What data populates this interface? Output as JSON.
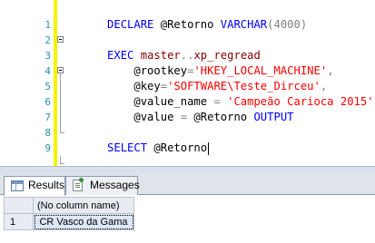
{
  "editor": {
    "lines": [
      {
        "num": "1"
      },
      {
        "num": "2"
      },
      {
        "num": "3"
      },
      {
        "num": "4"
      },
      {
        "num": "5"
      },
      {
        "num": "6"
      },
      {
        "num": "7"
      },
      {
        "num": "8"
      },
      {
        "num": "9"
      }
    ],
    "tokens": {
      "l1_declare": "DECLARE",
      "l1_var": " @Retorno ",
      "l1_type": "VARCHAR",
      "l1_size": "(4000)",
      "l3_exec": "EXEC",
      "l3_proc": " master",
      "l3_dots": "..",
      "l3_name": "xp_regread",
      "l4_param": "    @rootkey",
      "l4_eq": "=",
      "l4_val": "'HKEY_LOCAL_MACHINE'",
      "l4_comma": ",",
      "l5_param": "    @key",
      "l5_eq": "=",
      "l5_val": "'SOFTWARE\\Teste_Dirceu'",
      "l5_comma": ",",
      "l6_param": "    @value_name ",
      "l6_eq": "=",
      "l6_val": " 'Campeão Carioca 2015'",
      "l6_comma": ",",
      "l7_param": "    @value ",
      "l7_eq": "=",
      "l7_var": " @Retorno ",
      "l7_out": "OUTPUT",
      "l9_select": "SELECT",
      "l9_var": " @Retorno"
    }
  },
  "results": {
    "tabs": [
      {
        "label": "Results",
        "icon": "grid-icon",
        "active": true
      },
      {
        "label": "Messages",
        "icon": "messages-icon",
        "active": false
      }
    ],
    "column_header": "(No column name)",
    "rows": [
      {
        "num": "1",
        "value": "CR Vasco da Gama"
      }
    ]
  },
  "colors": {
    "keyword": "#0000ff",
    "system_object": "#800000",
    "string": "#ff0000",
    "line_number": "#2b91af",
    "change_bar": "#f4f404"
  }
}
